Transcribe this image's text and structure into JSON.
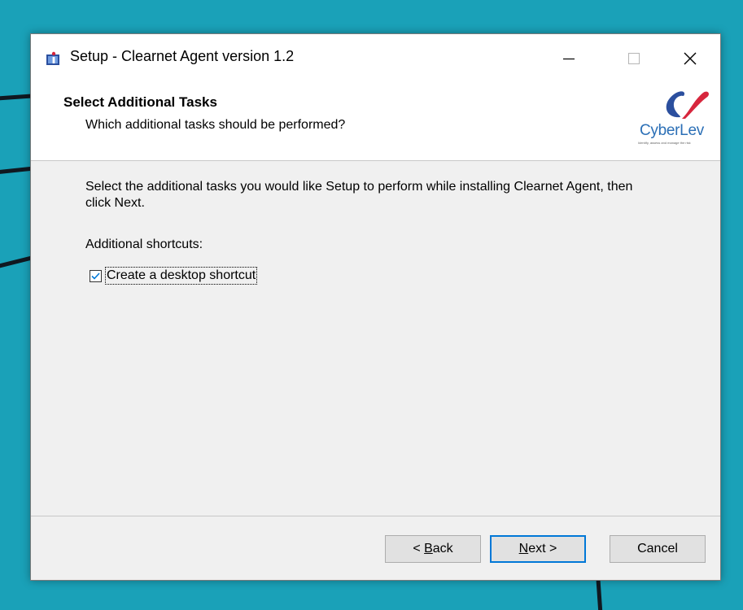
{
  "window": {
    "title": "Setup - Clearnet Agent version 1.2",
    "controls": {
      "minimize_icon": "minimize-icon",
      "maximize_icon": "maximize-icon",
      "close_icon": "close-icon"
    }
  },
  "header": {
    "title": "Select Additional Tasks",
    "subtitle": "Which additional tasks should be performed?",
    "logo": {
      "name": "CyberLev",
      "tagline": "Identify, assess and manage the risk",
      "colors": {
        "blue": "#2b6fb6",
        "red": "#d7263d"
      }
    }
  },
  "content": {
    "instructions": "Select the additional tasks you would like Setup to perform while installing Clearnet Agent, then click Next.",
    "section_label": "Additional shortcuts:",
    "tasks": [
      {
        "label": "Create a desktop shortcut",
        "checked": true
      }
    ]
  },
  "buttons": {
    "back": {
      "prefix": "< ",
      "mnemonic": "B",
      "rest": "ack"
    },
    "next": {
      "mnemonic": "N",
      "rest": "ext >"
    },
    "cancel": "Cancel"
  },
  "colors": {
    "desktop": "#1aa1b8",
    "accent": "#0078d7",
    "window_bg": "#f0f0f0"
  }
}
